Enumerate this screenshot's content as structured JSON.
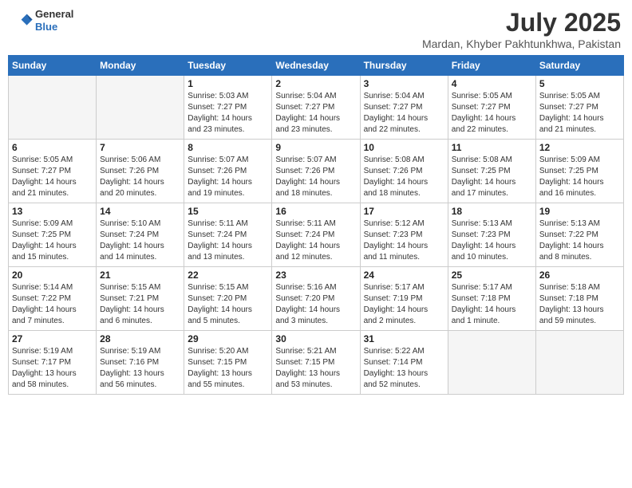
{
  "header": {
    "logo": {
      "general": "General",
      "blue": "Blue"
    },
    "title": "July 2025",
    "subtitle": "Mardan, Khyber Pakhtunkhwa, Pakistan"
  },
  "calendar": {
    "days_of_week": [
      "Sunday",
      "Monday",
      "Tuesday",
      "Wednesday",
      "Thursday",
      "Friday",
      "Saturday"
    ],
    "weeks": [
      [
        {
          "day": "",
          "info": ""
        },
        {
          "day": "",
          "info": ""
        },
        {
          "day": "1",
          "info": "Sunrise: 5:03 AM\nSunset: 7:27 PM\nDaylight: 14 hours\nand 23 minutes."
        },
        {
          "day": "2",
          "info": "Sunrise: 5:04 AM\nSunset: 7:27 PM\nDaylight: 14 hours\nand 23 minutes."
        },
        {
          "day": "3",
          "info": "Sunrise: 5:04 AM\nSunset: 7:27 PM\nDaylight: 14 hours\nand 22 minutes."
        },
        {
          "day": "4",
          "info": "Sunrise: 5:05 AM\nSunset: 7:27 PM\nDaylight: 14 hours\nand 22 minutes."
        },
        {
          "day": "5",
          "info": "Sunrise: 5:05 AM\nSunset: 7:27 PM\nDaylight: 14 hours\nand 21 minutes."
        }
      ],
      [
        {
          "day": "6",
          "info": "Sunrise: 5:05 AM\nSunset: 7:27 PM\nDaylight: 14 hours\nand 21 minutes."
        },
        {
          "day": "7",
          "info": "Sunrise: 5:06 AM\nSunset: 7:26 PM\nDaylight: 14 hours\nand 20 minutes."
        },
        {
          "day": "8",
          "info": "Sunrise: 5:07 AM\nSunset: 7:26 PM\nDaylight: 14 hours\nand 19 minutes."
        },
        {
          "day": "9",
          "info": "Sunrise: 5:07 AM\nSunset: 7:26 PM\nDaylight: 14 hours\nand 18 minutes."
        },
        {
          "day": "10",
          "info": "Sunrise: 5:08 AM\nSunset: 7:26 PM\nDaylight: 14 hours\nand 18 minutes."
        },
        {
          "day": "11",
          "info": "Sunrise: 5:08 AM\nSunset: 7:25 PM\nDaylight: 14 hours\nand 17 minutes."
        },
        {
          "day": "12",
          "info": "Sunrise: 5:09 AM\nSunset: 7:25 PM\nDaylight: 14 hours\nand 16 minutes."
        }
      ],
      [
        {
          "day": "13",
          "info": "Sunrise: 5:09 AM\nSunset: 7:25 PM\nDaylight: 14 hours\nand 15 minutes."
        },
        {
          "day": "14",
          "info": "Sunrise: 5:10 AM\nSunset: 7:24 PM\nDaylight: 14 hours\nand 14 minutes."
        },
        {
          "day": "15",
          "info": "Sunrise: 5:11 AM\nSunset: 7:24 PM\nDaylight: 14 hours\nand 13 minutes."
        },
        {
          "day": "16",
          "info": "Sunrise: 5:11 AM\nSunset: 7:24 PM\nDaylight: 14 hours\nand 12 minutes."
        },
        {
          "day": "17",
          "info": "Sunrise: 5:12 AM\nSunset: 7:23 PM\nDaylight: 14 hours\nand 11 minutes."
        },
        {
          "day": "18",
          "info": "Sunrise: 5:13 AM\nSunset: 7:23 PM\nDaylight: 14 hours\nand 10 minutes."
        },
        {
          "day": "19",
          "info": "Sunrise: 5:13 AM\nSunset: 7:22 PM\nDaylight: 14 hours\nand 8 minutes."
        }
      ],
      [
        {
          "day": "20",
          "info": "Sunrise: 5:14 AM\nSunset: 7:22 PM\nDaylight: 14 hours\nand 7 minutes."
        },
        {
          "day": "21",
          "info": "Sunrise: 5:15 AM\nSunset: 7:21 PM\nDaylight: 14 hours\nand 6 minutes."
        },
        {
          "day": "22",
          "info": "Sunrise: 5:15 AM\nSunset: 7:20 PM\nDaylight: 14 hours\nand 5 minutes."
        },
        {
          "day": "23",
          "info": "Sunrise: 5:16 AM\nSunset: 7:20 PM\nDaylight: 14 hours\nand 3 minutes."
        },
        {
          "day": "24",
          "info": "Sunrise: 5:17 AM\nSunset: 7:19 PM\nDaylight: 14 hours\nand 2 minutes."
        },
        {
          "day": "25",
          "info": "Sunrise: 5:17 AM\nSunset: 7:18 PM\nDaylight: 14 hours\nand 1 minute."
        },
        {
          "day": "26",
          "info": "Sunrise: 5:18 AM\nSunset: 7:18 PM\nDaylight: 13 hours\nand 59 minutes."
        }
      ],
      [
        {
          "day": "27",
          "info": "Sunrise: 5:19 AM\nSunset: 7:17 PM\nDaylight: 13 hours\nand 58 minutes."
        },
        {
          "day": "28",
          "info": "Sunrise: 5:19 AM\nSunset: 7:16 PM\nDaylight: 13 hours\nand 56 minutes."
        },
        {
          "day": "29",
          "info": "Sunrise: 5:20 AM\nSunset: 7:15 PM\nDaylight: 13 hours\nand 55 minutes."
        },
        {
          "day": "30",
          "info": "Sunrise: 5:21 AM\nSunset: 7:15 PM\nDaylight: 13 hours\nand 53 minutes."
        },
        {
          "day": "31",
          "info": "Sunrise: 5:22 AM\nSunset: 7:14 PM\nDaylight: 13 hours\nand 52 minutes."
        },
        {
          "day": "",
          "info": ""
        },
        {
          "day": "",
          "info": ""
        }
      ]
    ]
  }
}
